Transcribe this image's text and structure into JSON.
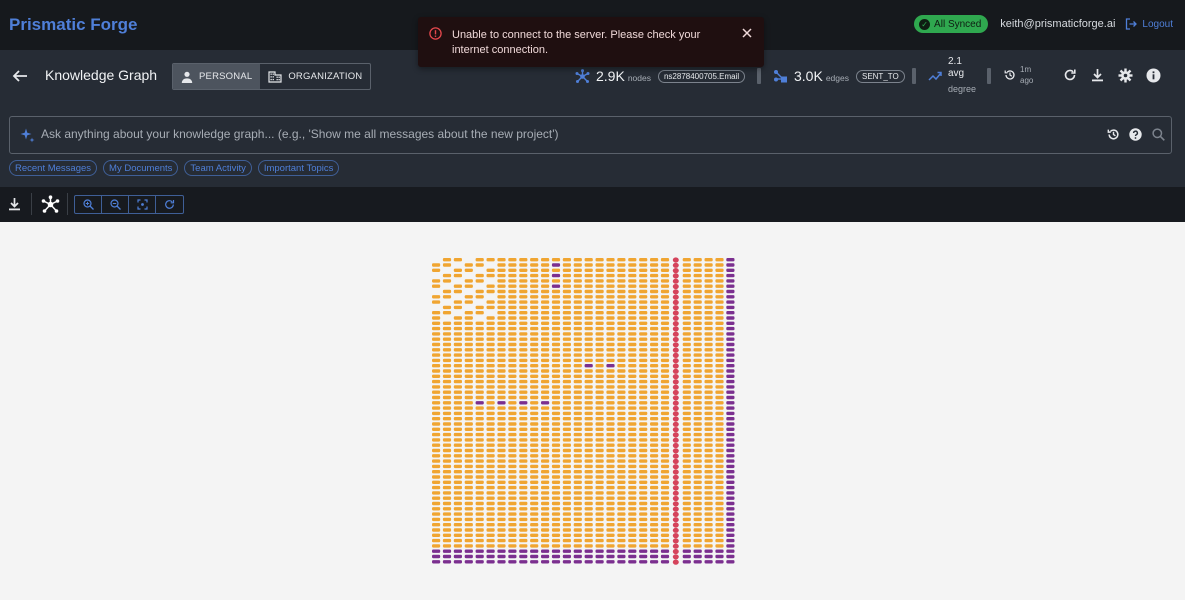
{
  "app": {
    "brand": "Prismatic Forge"
  },
  "account": {
    "sync_status": "All Synced",
    "email": "keith@prismaticforge.ai",
    "logout_label": "Logout"
  },
  "header": {
    "title": "Knowledge Graph",
    "scope_options": [
      "PERSONAL",
      "ORGANIZATION"
    ],
    "scope_selected": "PERSONAL"
  },
  "stats": {
    "nodes_value": "2.9K",
    "nodes_label": "nodes",
    "nodes_chip": "ns2878400705.Email",
    "edges_value": "3.0K",
    "edges_label": "edges",
    "edges_chip": "SENT_TO",
    "avg_value": "2.1",
    "avg_label": "avg",
    "avg_sub": "degree",
    "updated_value": "1m",
    "updated_sub": "ago"
  },
  "search": {
    "placeholder": "Ask anything about your knowledge graph... (e.g., 'Show me all messages about the new project')",
    "value": ""
  },
  "suggestions": [
    "Recent Messages",
    "My Documents",
    "Team Activity",
    "Important Topics"
  ],
  "toast": {
    "message": "Unable to connect to the server. Please check your internet connection."
  },
  "colors": {
    "brand": "#4f7fd8",
    "synced": "#2fa84f",
    "node_orange": "#f0a531",
    "node_purple": "#7b2f8f",
    "node_red": "#d5435b"
  },
  "icons": {
    "back": "arrow-left-icon",
    "personal": "person-icon",
    "organization": "building-icon",
    "nodes": "network-icon",
    "edges": "hub-icon",
    "degree": "trending-up-icon",
    "updated": "history-icon",
    "refresh": "refresh-icon",
    "download": "download-icon",
    "settings": "gear-icon",
    "info": "info-icon",
    "ai": "sparkle-icon",
    "history": "history-icon",
    "help": "help-icon",
    "search": "search-icon",
    "zoom_in": "zoom-in-icon",
    "zoom_out": "zoom-out-icon",
    "fit": "fit-screen-icon",
    "reset": "reset-icon",
    "error": "error-icon",
    "close": "close-icon"
  }
}
